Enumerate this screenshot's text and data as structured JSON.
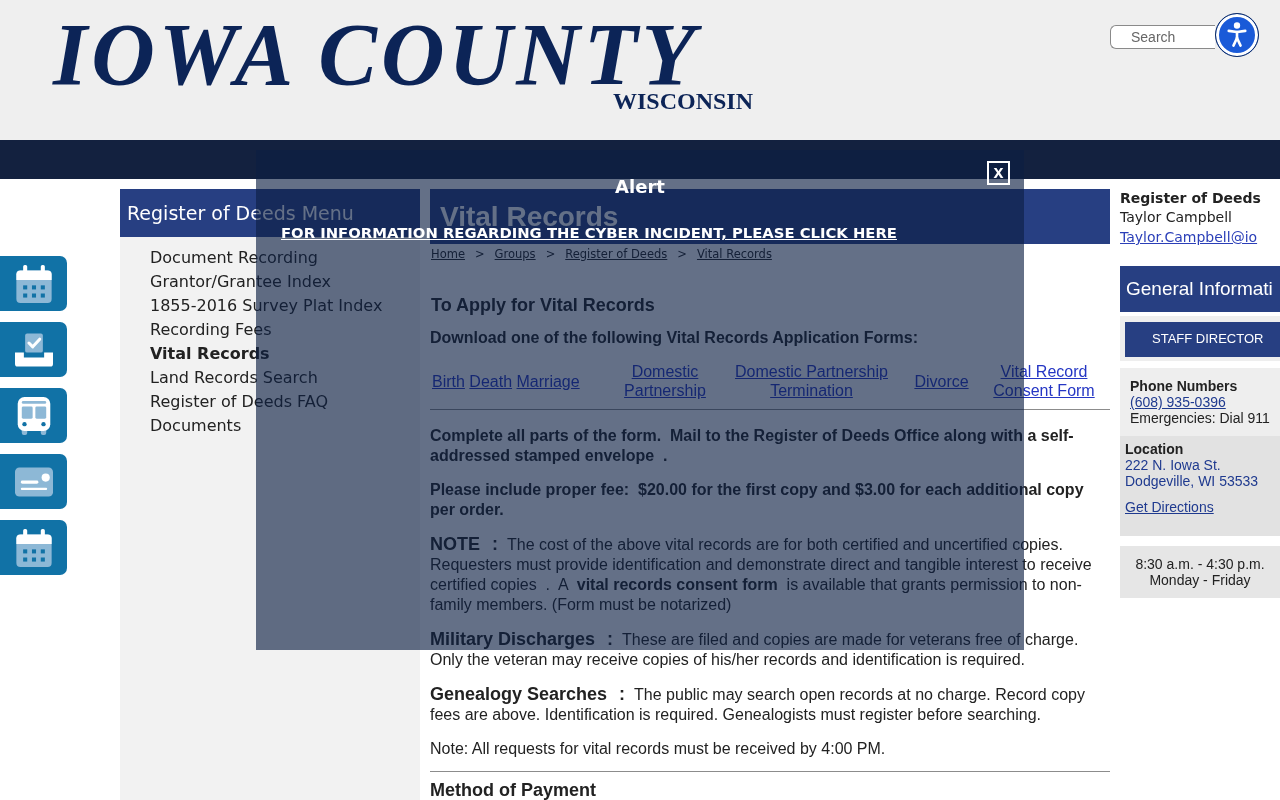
{
  "header": {
    "logo_title": "IOWA COUNTY",
    "logo_subtitle": "WISCONSIN",
    "search": {
      "placeholder": "Search"
    }
  },
  "side_menu": {
    "title": "Register of Deeds Menu",
    "items": [
      {
        "label": "Document Recording",
        "selected": false
      },
      {
        "label": "Grantor/Grantee Index",
        "selected": false
      },
      {
        "label": "1855-2016 Survey Plat Index",
        "selected": false
      },
      {
        "label": "Recording Fees",
        "selected": false
      },
      {
        "label": "Vital Records",
        "selected": true
      },
      {
        "label": "Land Records Search",
        "selected": false
      },
      {
        "label": "Register of Deeds FAQ",
        "selected": false
      },
      {
        "label": "Documents",
        "selected": false
      }
    ]
  },
  "main": {
    "title": "Vital Records",
    "breadcrumb": [
      {
        "kind": "link",
        "text": "Home"
      },
      {
        "kind": "separator",
        "text": ">"
      },
      {
        "kind": "link",
        "text": "Groups"
      },
      {
        "kind": "separator",
        "text": ">"
      },
      {
        "kind": "link",
        "text": "Register of Deeds"
      },
      {
        "kind": "separator",
        "text": ">"
      },
      {
        "kind": "link",
        "text": "Vital Records"
      }
    ],
    "section_title": "To Apply for Vital Records",
    "forms_intro": "Download one of the following Vital Records Application Forms:",
    "form_links": [
      [
        "Birth",
        "Death",
        "Marriage"
      ],
      [
        "Domestic Partnership"
      ],
      [
        "Domestic Partnership Termination"
      ],
      [
        "Divorce"
      ],
      [
        "Vital Record Consent Form"
      ]
    ],
    "paragraphs": [
      {
        "kind": "bold",
        "text": "Complete all parts of the form.  Mail to the Register of Deeds Office along with a self-addressed stamped envelope  ."
      },
      {
        "kind": "bold",
        "text": "Please include proper fee:  $20.00 for the first copy and $3.00 for each additional copy per order."
      },
      {
        "kind": "lead",
        "lead": "NOTE",
        "colon": ":",
        "text": "The cost of the above vital records are for both certified and uncertified copies. Requesters must provide identification and demonstrate direct and tangible interest to receive certified copies  .  A  **vital records consent form**  is available that grants permission to non-family members. (Form must be notarized)"
      },
      {
        "kind": "lead",
        "lead": "Military Discharges",
        "colon": ":",
        "text": "These are filed and copies are made for veterans free of charge. Only the veteran may receive copies of his/her records and identification is required."
      },
      {
        "kind": "lead",
        "lead": "Genealogy Searches",
        "colon": ":",
        "text": "The public may search open records at no charge. Record copy fees are above. Identification is required. Genealogists must register before searching."
      },
      {
        "kind": "plain",
        "text": "Note: All requests for vital records must be received by 4:00 PM."
      }
    ],
    "payment_heading": "Method of Payment"
  },
  "contact": {
    "title": "Register of Deeds",
    "name": "Taylor Campbell",
    "email": "Taylor.Campbell@io"
  },
  "general_info": {
    "title": "General Informati",
    "staff_button": "STAFF DIRECTOR",
    "phone": {
      "heading": "Phone Numbers",
      "number": "(608) 935-0396",
      "emergency": "Emergencies: Dial 911"
    },
    "location": {
      "heading": "Location",
      "lines": [
        "222 N. Iowa St.",
        "Dodgeville, WI 53533"
      ],
      "directions": "Get Directions"
    },
    "hours": [
      "8:30 a.m. - 4:30 p.m.",
      "Monday - Friday"
    ]
  },
  "alert": {
    "title": "Alert",
    "link": "FOR INFORMATION REGARDING THE CYBER INCIDENT, PLEASE CLICK HERE",
    "close": "x"
  }
}
